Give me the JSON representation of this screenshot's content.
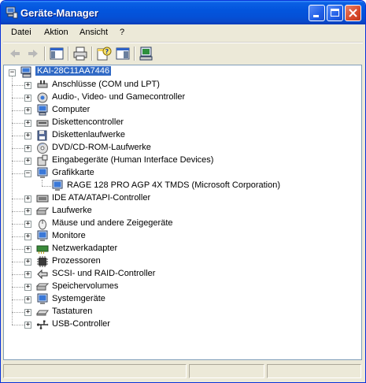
{
  "window": {
    "title": "Geräte-Manager",
    "accent": "#0055e5",
    "selection_color": "#316ac5"
  },
  "menubar": {
    "items": [
      "Datei",
      "Aktion",
      "Ansicht",
      "?"
    ]
  },
  "toolbar": {
    "icons": [
      "back-arrow-icon",
      "forward-arrow-icon",
      "console-tree-icon",
      "print-icon",
      "properties-help-icon",
      "properties-icon",
      "scan-hardware-icon"
    ]
  },
  "tree": {
    "root": "KAI-28C11AA7446",
    "categories": [
      {
        "label": "Anschlüsse (COM und LPT)",
        "icon": "port-icon"
      },
      {
        "label": "Audio-, Video- und Gamecontroller",
        "icon": "sound-icon"
      },
      {
        "label": "Computer",
        "icon": "computer-icon"
      },
      {
        "label": "Diskettencontroller",
        "icon": "floppy-controller-icon"
      },
      {
        "label": "Diskettenlaufwerke",
        "icon": "floppy-drive-icon"
      },
      {
        "label": "DVD/CD-ROM-Laufwerke",
        "icon": "cdrom-icon"
      },
      {
        "label": "Eingabegeräte (Human Interface Devices)",
        "icon": "hid-icon"
      },
      {
        "label": "Grafikkarte",
        "icon": "display-adapter-icon",
        "expanded": true,
        "children": [
          {
            "label": "RAGE 128 PRO AGP 4X TMDS (Microsoft Corporation)",
            "icon": "display-adapter-icon"
          }
        ]
      },
      {
        "label": "IDE ATA/ATAPI-Controller",
        "icon": "ide-icon"
      },
      {
        "label": "Laufwerke",
        "icon": "disk-drive-icon"
      },
      {
        "label": "Mäuse und andere Zeigegeräte",
        "icon": "mouse-icon"
      },
      {
        "label": "Monitore",
        "icon": "monitor-icon"
      },
      {
        "label": "Netzwerkadapter",
        "icon": "network-adapter-icon"
      },
      {
        "label": "Prozessoren",
        "icon": "processor-icon"
      },
      {
        "label": "SCSI- und RAID-Controller",
        "icon": "scsi-icon"
      },
      {
        "label": "Speichervolumes",
        "icon": "storage-volume-icon"
      },
      {
        "label": "Systemgeräte",
        "icon": "system-device-icon"
      },
      {
        "label": "Tastaturen",
        "icon": "keyboard-icon"
      },
      {
        "label": "USB-Controller",
        "icon": "usb-icon"
      }
    ]
  }
}
